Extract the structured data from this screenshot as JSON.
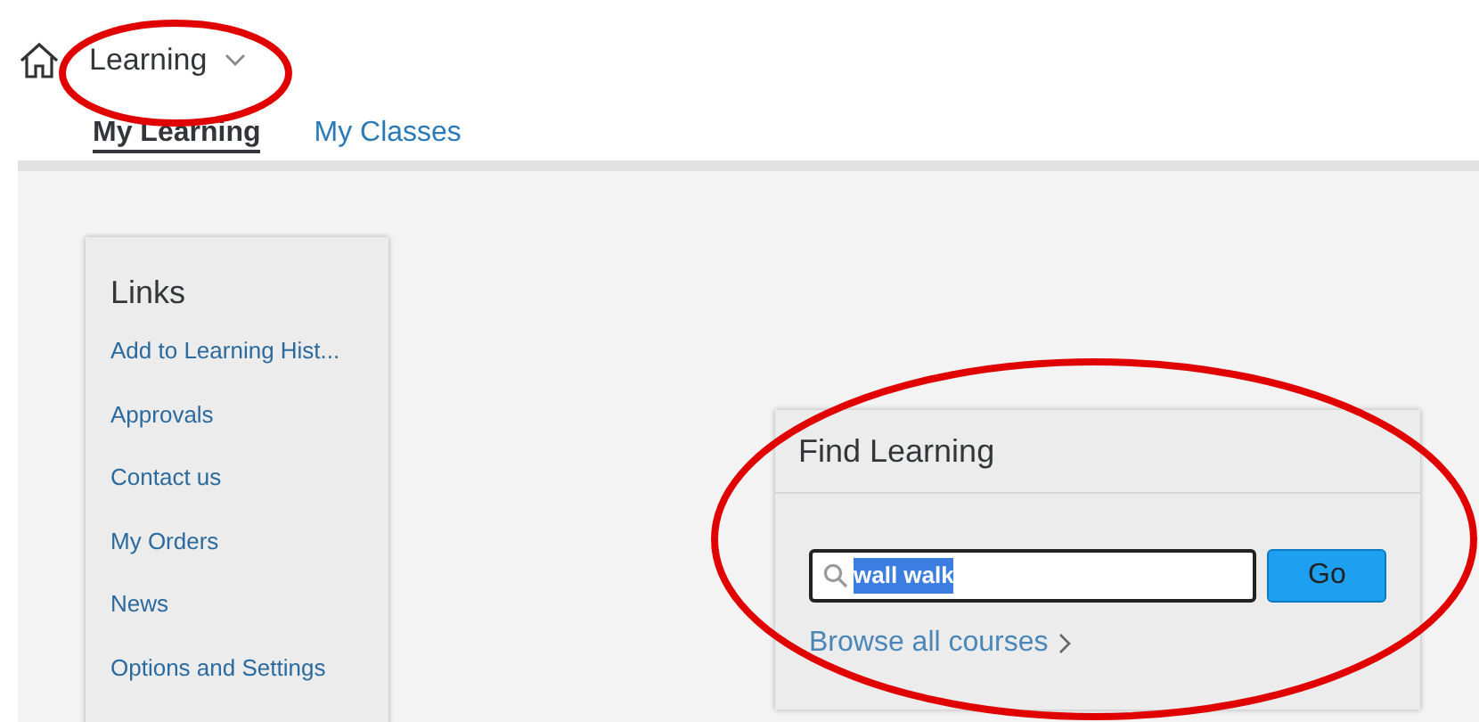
{
  "header": {
    "title": "Learning"
  },
  "tabs": [
    {
      "label": "My Learning",
      "selected": true
    },
    {
      "label": "My Classes",
      "selected": false
    }
  ],
  "links": {
    "title": "Links",
    "items": [
      "Add to Learning Hist...",
      "Approvals",
      "Contact us",
      "My Orders",
      "News",
      "Options and Settings"
    ]
  },
  "find_learning": {
    "title": "Find Learning",
    "search": {
      "value": "wall walk",
      "selected_text": true
    },
    "button": "Go",
    "browse_link": "Browse all courses"
  },
  "annotations": [
    {
      "kind": "ellipse"
    },
    {
      "kind": "ellipse"
    }
  ]
}
